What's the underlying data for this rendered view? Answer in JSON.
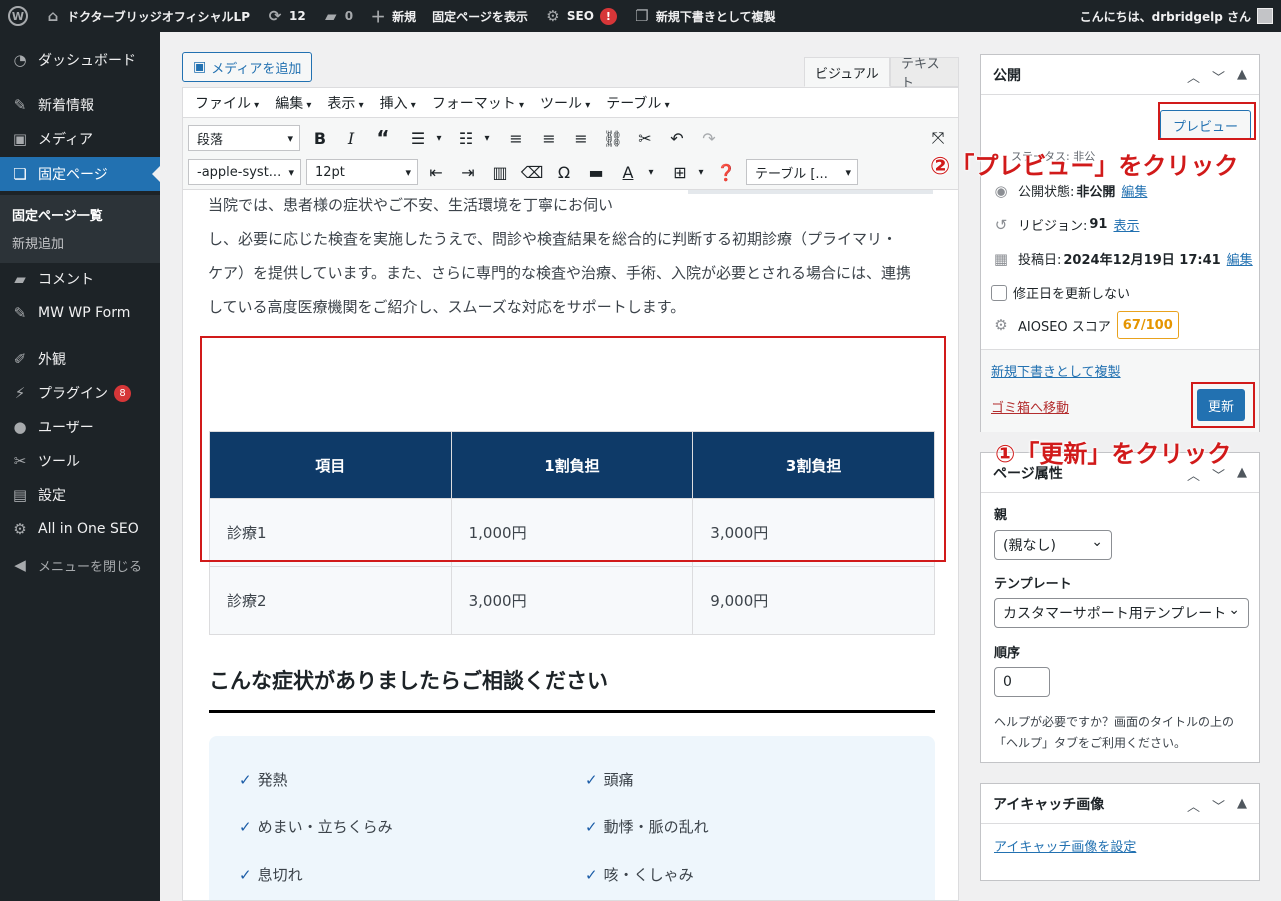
{
  "adminbar": {
    "site_name": "ドクターブリッジオフィシャルLP",
    "updates": "12",
    "comments": "0",
    "new": "新規",
    "view_page": "固定ページを表示",
    "seo": "SEO",
    "seo_alert": "!",
    "duplicate": "新規下書きとして複製",
    "greeting": "こんにちは、drbridgelp さん"
  },
  "sidebar": {
    "items": [
      {
        "label": "ダッシュボード",
        "icon": "dashboard-icon"
      },
      {
        "label": "新着情報",
        "icon": "pin-icon"
      },
      {
        "label": "メディア",
        "icon": "media-icon"
      },
      {
        "label": "固定ページ",
        "icon": "pages-icon"
      },
      {
        "label": "コメント",
        "icon": "comment-icon"
      },
      {
        "label": "MW WP Form",
        "icon": "pin-icon"
      },
      {
        "label": "外観",
        "icon": "appearance-icon"
      },
      {
        "label": "プラグイン",
        "icon": "plugin-icon",
        "badge": "8"
      },
      {
        "label": "ユーザー",
        "icon": "user-icon"
      },
      {
        "label": "ツール",
        "icon": "tools-icon"
      },
      {
        "label": "設定",
        "icon": "settings-icon"
      },
      {
        "label": "All in One SEO",
        "icon": "aioseo-icon"
      }
    ],
    "submenu": [
      "固定ページ一覧",
      "新規追加"
    ],
    "collapse": "メニューを閉じる"
  },
  "editor": {
    "add_media": "メディアを追加",
    "tab_visual": "ビジュアル",
    "tab_text": "テキスト",
    "menus": [
      "ファイル",
      "編集",
      "表示",
      "挿入",
      "フォーマット",
      "ツール",
      "テーブル"
    ],
    "format_select": "段落",
    "font_select": "-apple-syst...",
    "size_select": "12pt",
    "table_select": "テーブル [...",
    "paragraph_lines": [
      "当院では、患者様の症状やご不安、生活環境を丁寧にお伺い",
      "し、必要に応じた検査を実施したうえで、問診や検査結果を総合的に判断する初期診療（プライマリ・",
      "ケア）を提供しています。また、さらに専門的な検査や治療、手術、入院が必要とされる場合には、連携",
      "している高度医療機関をご紹介し、スムーズな対応をサポートします。"
    ],
    "table": {
      "headers": [
        "項目",
        "1割負担",
        "3割負担"
      ],
      "rows": [
        [
          "診療1",
          "1,000円",
          "3,000円"
        ],
        [
          "診療2",
          "3,000円",
          "9,000円"
        ]
      ]
    },
    "heading": "こんな症状がありましたらご相談ください",
    "symptoms": [
      "発熱",
      "頭痛",
      "めまい・立ちくらみ",
      "動悸・脈の乱れ",
      "息切れ",
      "咳・くしゃみ"
    ]
  },
  "publish": {
    "title": "公開",
    "preview": "プレビュー",
    "cut_text": "ステータス: 非公",
    "status_label": "公開状態:",
    "status_value": "非公開",
    "status_edit": "編集",
    "revisions_label": "リビジョン:",
    "revisions_value": "91",
    "revisions_link": "表示",
    "date_label": "投稿日:",
    "date_value": "2024年12月19日 17:41",
    "date_edit": "編集",
    "no_update_date": "修正日を更新しない",
    "aioseo_label": "AIOSEO スコア",
    "aioseo_score": "67/100",
    "duplicate": "新規下書きとして複製",
    "trash": "ゴミ箱へ移動",
    "update": "更新"
  },
  "attributes": {
    "title": "ページ属性",
    "parent_label": "親",
    "parent_value": "(親なし)",
    "template_label": "テンプレート",
    "template_value": "カスタマーサポート用テンプレート",
    "order_label": "順序",
    "order_value": "0",
    "help": "ヘルプが必要ですか？画面のタイトルの上の「ヘルプ」タブをご利用ください。"
  },
  "featured": {
    "title": "アイキャッチ画像",
    "set_link": "アイキャッチ画像を設定"
  },
  "annotations": {
    "preview": "②「プレビュー」をクリック",
    "update": "①「更新」をクリック"
  },
  "colors": {
    "admin_dark": "#1d2327",
    "accent": "#2271b1",
    "table_header": "#0e3a68",
    "annotation_red": "#d11a1a",
    "score_orange": "#e59500"
  }
}
